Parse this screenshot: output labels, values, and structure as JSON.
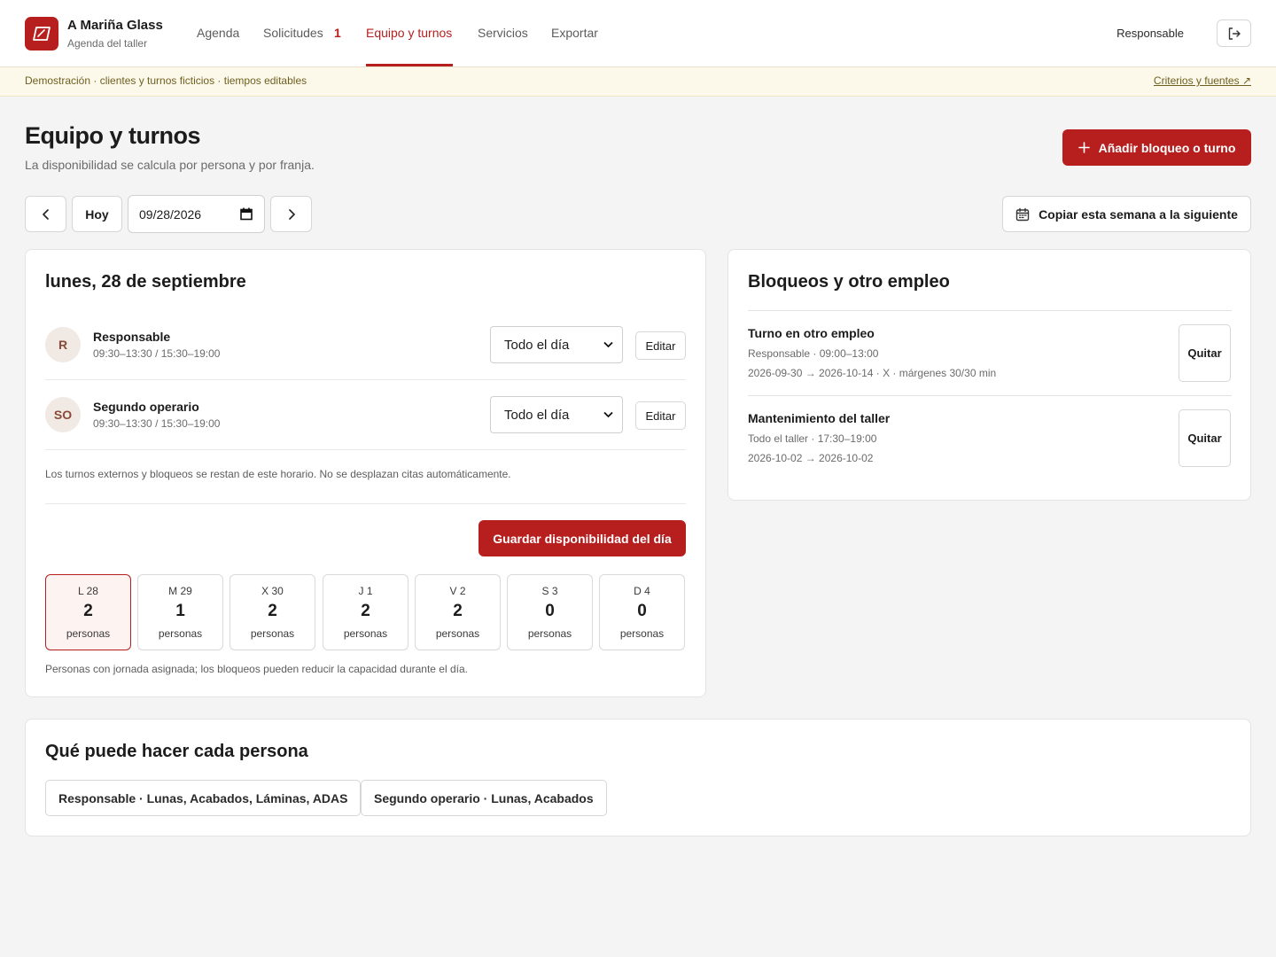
{
  "brand": {
    "name": "A Mariña Glass",
    "subtitle": "Agenda del taller",
    "icon": "windshield-icon"
  },
  "nav": {
    "items": [
      {
        "label": "Agenda",
        "active": false
      },
      {
        "label": "Solicitudes",
        "badge": "1",
        "active": false
      },
      {
        "label": "Equipo y turnos",
        "active": true
      },
      {
        "label": "Servicios",
        "active": false
      },
      {
        "label": "Exportar",
        "active": false
      }
    ],
    "user": "Responsable",
    "logout_icon": "logout-icon"
  },
  "banner": {
    "text": "Demostración · clientes y turnos ficticios · tiempos editables",
    "link": "Criterios y fuentes ↗"
  },
  "page": {
    "title": "Equipo y turnos",
    "subtitle": "La disponibilidad se calcula por persona y por franja.",
    "add_button": "Añadir bloqueo o turno"
  },
  "date_controls": {
    "today": "Hoy",
    "date_value": "09/28/2026",
    "copy_button": "Copiar esta semana a la siguiente"
  },
  "day_card": {
    "title": "lunes, 28 de septiembre",
    "people": [
      {
        "initials": "R",
        "name": "Responsable",
        "hours": "09:30–13:30 / 15:30–19:00",
        "select": "Todo el día",
        "edit": "Editar"
      },
      {
        "initials": "SO",
        "name": "Segundo operario",
        "hours": "09:30–13:30 / 15:30–19:00",
        "select": "Todo el día",
        "edit": "Editar"
      }
    ],
    "note": "Los turnos externos y bloqueos se restan de este horario. No se desplazan citas automáticamente.",
    "save_button": "Guardar disponibilidad del día",
    "week": [
      {
        "label": "L 28",
        "count": "2",
        "unit": "personas",
        "selected": true
      },
      {
        "label": "M 29",
        "count": "1",
        "unit": "personas",
        "selected": false
      },
      {
        "label": "X 30",
        "count": "2",
        "unit": "personas",
        "selected": false
      },
      {
        "label": "J 1",
        "count": "2",
        "unit": "personas",
        "selected": false
      },
      {
        "label": "V 2",
        "count": "2",
        "unit": "personas",
        "selected": false
      },
      {
        "label": "S 3",
        "count": "0",
        "unit": "personas",
        "selected": false
      },
      {
        "label": "D 4",
        "count": "0",
        "unit": "personas",
        "selected": false
      }
    ],
    "footnote": "Personas con jornada asignada; los bloqueos pueden reducir la capacidad durante el día."
  },
  "blocks_card": {
    "title": "Bloqueos y otro empleo",
    "items": [
      {
        "title": "Turno en otro empleo",
        "line1": "Responsable · 09:00–13:00",
        "line2": "2026-09-30 → 2026-10-14 · X · márgenes 30/30 min",
        "remove": "Quitar"
      },
      {
        "title": "Mantenimiento del taller",
        "line1": "Todo el taller · 17:30–19:00",
        "line2": "2026-10-02 → 2026-10-02",
        "remove": "Quitar"
      }
    ]
  },
  "skills_card": {
    "title": "Qué puede hacer cada persona",
    "chips": [
      "Responsable · Lunas, Acabados, Láminas, ADAS",
      "Segundo operario · Lunas, Acabados"
    ]
  },
  "colors": {
    "accent": "#b71f1f",
    "banner_bg": "#fdf9ea",
    "page_bg": "#f4f4f5"
  }
}
